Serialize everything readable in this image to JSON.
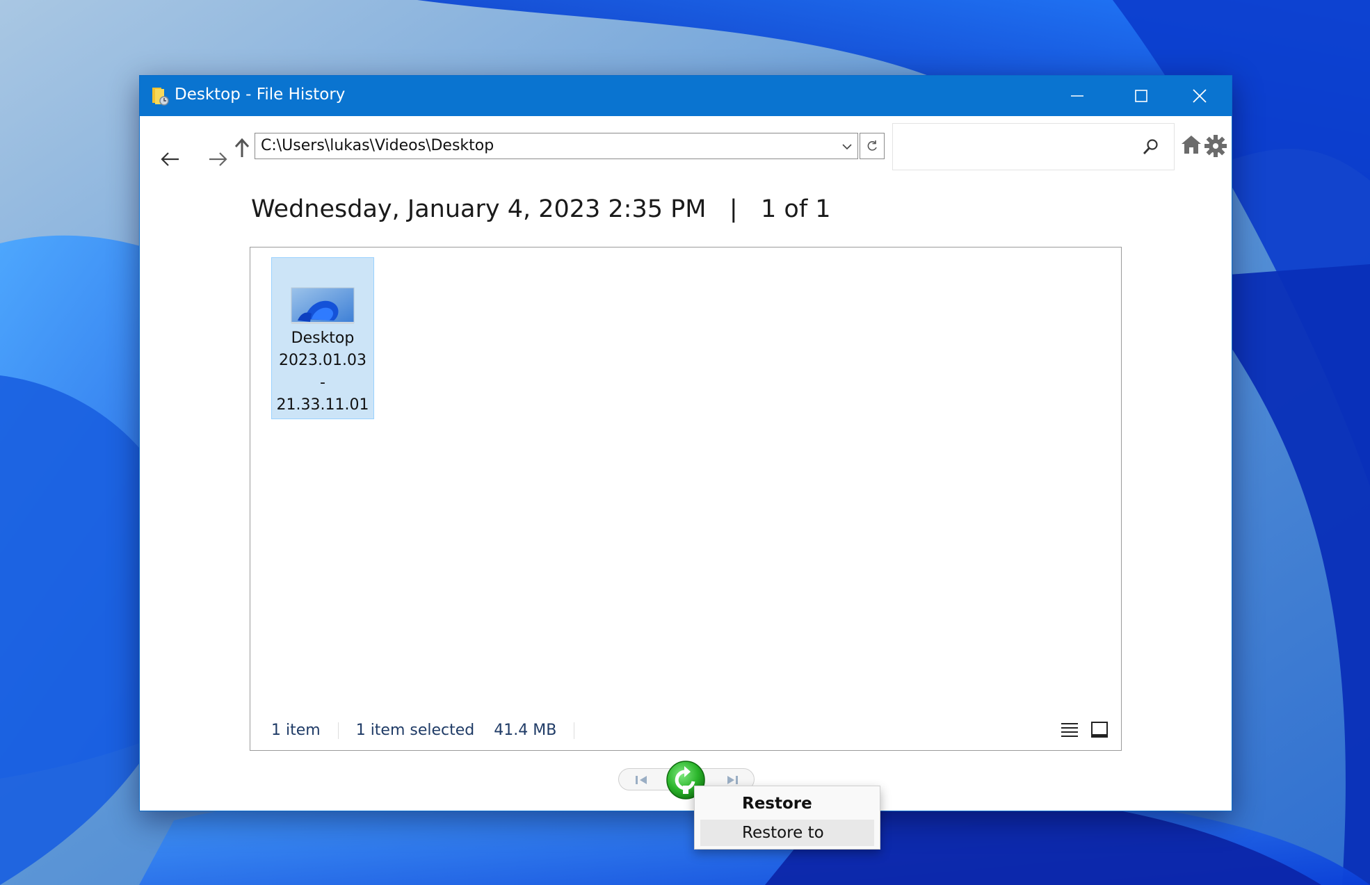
{
  "window": {
    "title": "Desktop - File History"
  },
  "navigation": {
    "address": "C:\\Users\\lukas\\Videos\\Desktop",
    "search_placeholder": ""
  },
  "header": {
    "date": "Wednesday, January 4, 2023 2:35 PM",
    "divider": "|",
    "page_position": "1 of 1"
  },
  "files": [
    {
      "name_lines": [
        "Desktop",
        "2023.01.03",
        "-",
        "21.33.11.01"
      ],
      "selected": true,
      "icon": "folder-thumbnail-icon"
    }
  ],
  "status_bar": {
    "item_count": "1 item",
    "selected_info": "1 item selected",
    "size": "41.4 MB"
  },
  "context_menu": {
    "items": [
      "Restore",
      "Restore to"
    ]
  },
  "colors": {
    "titlebar": "#0a74d0",
    "selection": "#cce4f7",
    "restore_green": "#2bb52b"
  }
}
